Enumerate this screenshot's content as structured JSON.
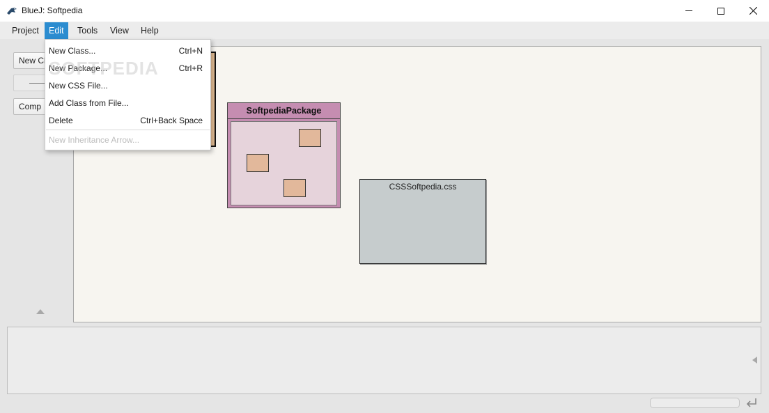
{
  "window": {
    "title": "BlueJ:  Softpedia"
  },
  "menubar": {
    "items": [
      "Project",
      "Edit",
      "Tools",
      "View",
      "Help"
    ],
    "active": "Edit"
  },
  "sidebar": {
    "new_class_label": "New Cl",
    "compile_label": "Comp"
  },
  "edit_menu": {
    "items": [
      {
        "label": "New Class...",
        "shortcut": "Ctrl+N",
        "enabled": true
      },
      {
        "label": "New Package...",
        "shortcut": "Ctrl+R",
        "enabled": true
      },
      {
        "label": "New CSS File...",
        "shortcut": "",
        "enabled": true
      },
      {
        "label": "Add Class from File...",
        "shortcut": "",
        "enabled": true
      },
      {
        "label": "Delete",
        "shortcut": "Ctrl+Back Space",
        "enabled": true
      },
      {
        "label": "New Inheritance Arrow...",
        "shortcut": "",
        "enabled": false
      }
    ]
  },
  "diagram": {
    "package_name": "SoftpediaPackage",
    "css_file_name": "CSSSoftpedia.css"
  },
  "watermark": "SOFTPEDIA",
  "colors": {
    "menu_highlight": "#2b8cd0",
    "package": "#c58db1",
    "class": "#e3bd94",
    "css_file": "#c6cccd"
  }
}
